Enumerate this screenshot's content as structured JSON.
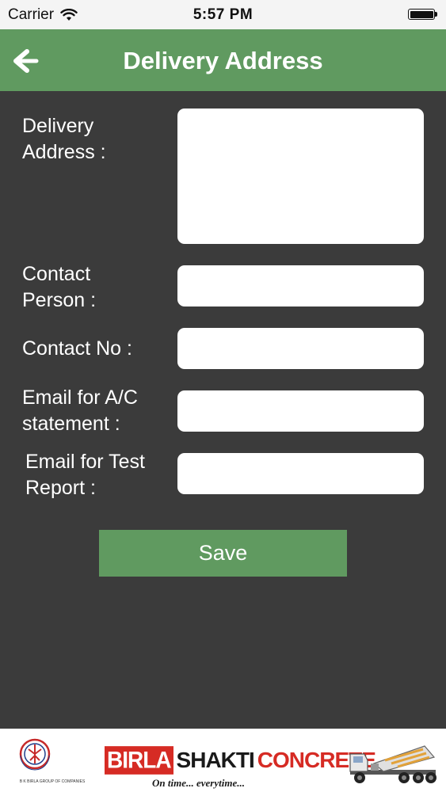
{
  "status_bar": {
    "carrier": "Carrier",
    "time": "5:57 PM",
    "wifi_icon": "wifi-icon",
    "battery_icon": "battery-icon"
  },
  "nav": {
    "title": "Delivery Address",
    "back_icon": "chevron-left-icon",
    "background_color": "#609a60"
  },
  "form": {
    "delivery_address_label_line1": "Delivery",
    "delivery_address_label_line2": "Address :",
    "delivery_address_value": "",
    "contact_person_label_line1": "Contact",
    "contact_person_label_line2": "Person :",
    "contact_person_value": "",
    "contact_no_label": "Contact No :",
    "contact_no_value": "",
    "email_ac_label_line1": "Email for A/C",
    "email_ac_label_line2": "statement :",
    "email_ac_value": "",
    "email_test_label_line1": "Email for Test",
    "email_test_label_line2": "Report :",
    "email_test_value": "",
    "save_label": "Save"
  },
  "footer": {
    "group_logo": "birla-group-logo",
    "group_logo_caption": "B K BIRLA GROUP OF COMPANIES",
    "brand_birla": "BIRLA",
    "brand_shakti": "SHAKTI",
    "brand_concrete": "CONCRETE",
    "tagline": "On time... everytime...",
    "truck_image": "concrete-mixer-truck-image"
  },
  "colors": {
    "accent": "#609a60",
    "background": "#3b3b3b",
    "brand_red": "#d62b24"
  }
}
